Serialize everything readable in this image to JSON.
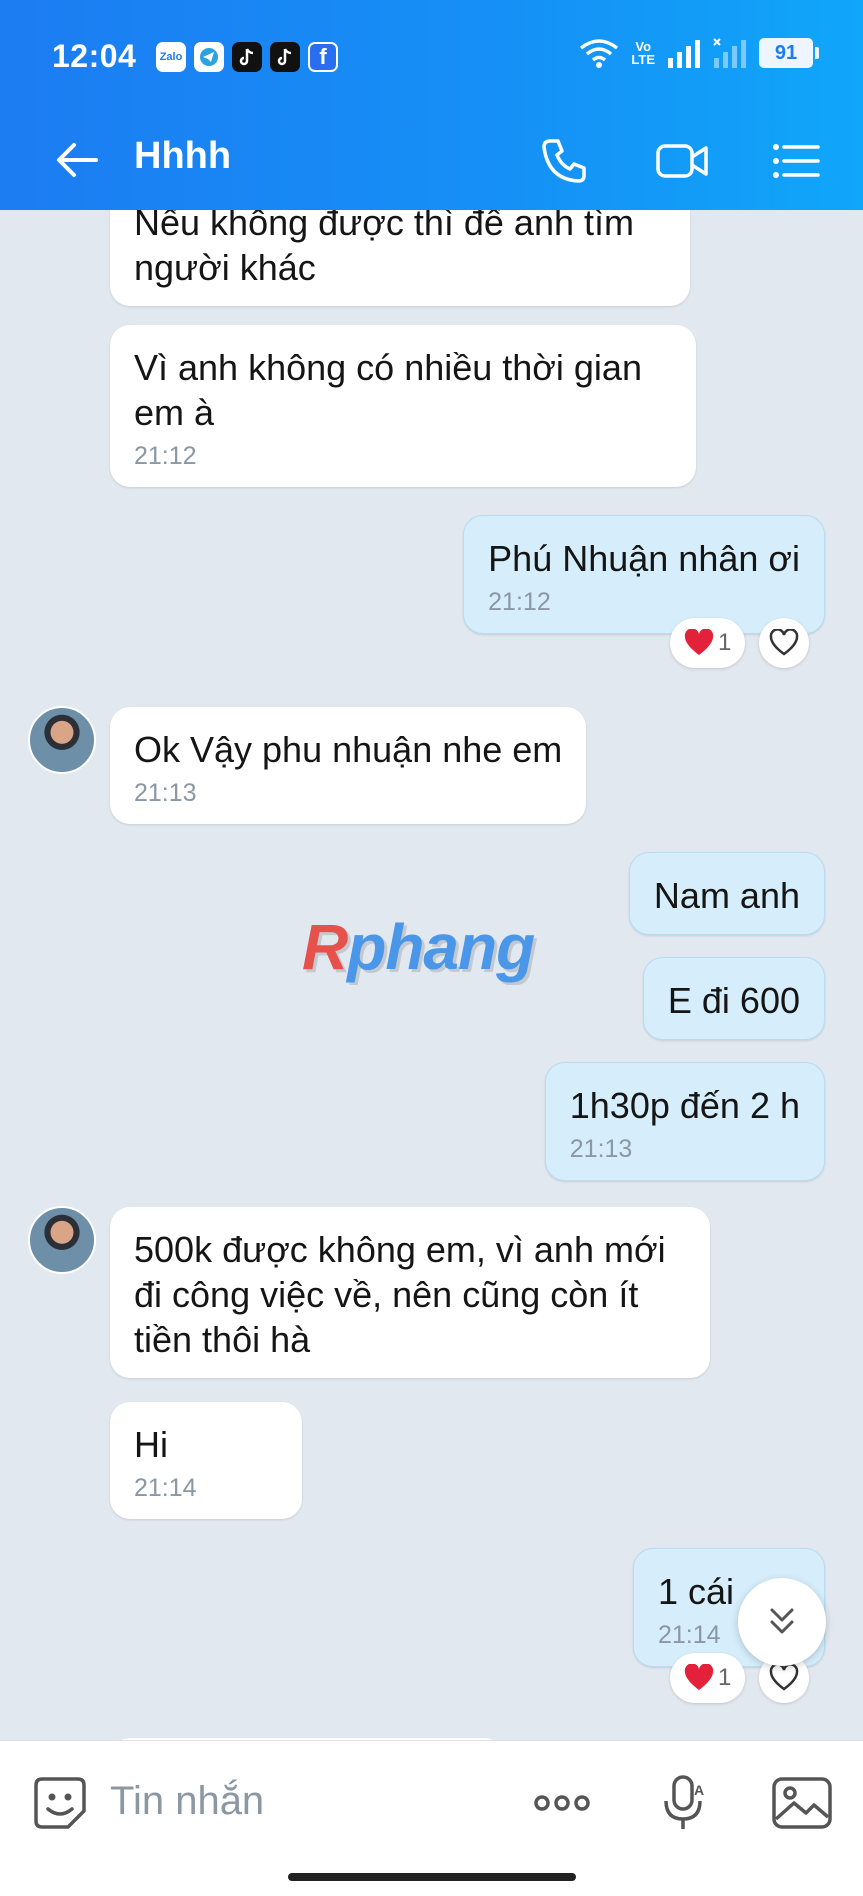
{
  "status_bar": {
    "time": "12:04",
    "apps": [
      "Zalo",
      "telegram-icon",
      "tiktok-icon",
      "tiktok-icon",
      "f"
    ],
    "volte_top": "Vo",
    "volte_bottom": "LTE",
    "battery": "91"
  },
  "header": {
    "title": "Hhhh"
  },
  "messages": [
    {
      "side": "in",
      "text": "Nếu không được thì để anh tìm người khác",
      "time": ""
    },
    {
      "side": "in",
      "text": "Vì anh không có nhiều thời gian em à",
      "time": "21:12"
    },
    {
      "side": "out",
      "text": "Phú Nhuận nhân ơi",
      "time": "21:12",
      "reaction_count": "1"
    },
    {
      "side": "in",
      "text": "Ok Vậy phu nhuận nhe em",
      "time": "21:13"
    },
    {
      "side": "out",
      "text": "Nam anh",
      "time": ""
    },
    {
      "side": "out",
      "text": "E đi 600",
      "time": ""
    },
    {
      "side": "out",
      "text": "1h30p đến 2 h",
      "time": "21:13"
    },
    {
      "side": "in",
      "text": "500k được không em, vì anh mới đi công việc về, nên cũng còn ít tiền thôi hà",
      "time": ""
    },
    {
      "side": "in",
      "text": "Hi",
      "time": "21:14"
    },
    {
      "side": "out",
      "text": "1 cái",
      "time": "21:14",
      "reaction_count": "1"
    }
  ],
  "watermark": {
    "r": "R",
    "rest": "phang"
  },
  "input": {
    "placeholder": "Tin nhắn"
  },
  "colors": {
    "header_start": "#1c7cf2",
    "header_end": "#10a6fa",
    "bubble_out": "#d6eefc",
    "bubble_in": "#ffffff",
    "background": "#e2e8ef"
  }
}
